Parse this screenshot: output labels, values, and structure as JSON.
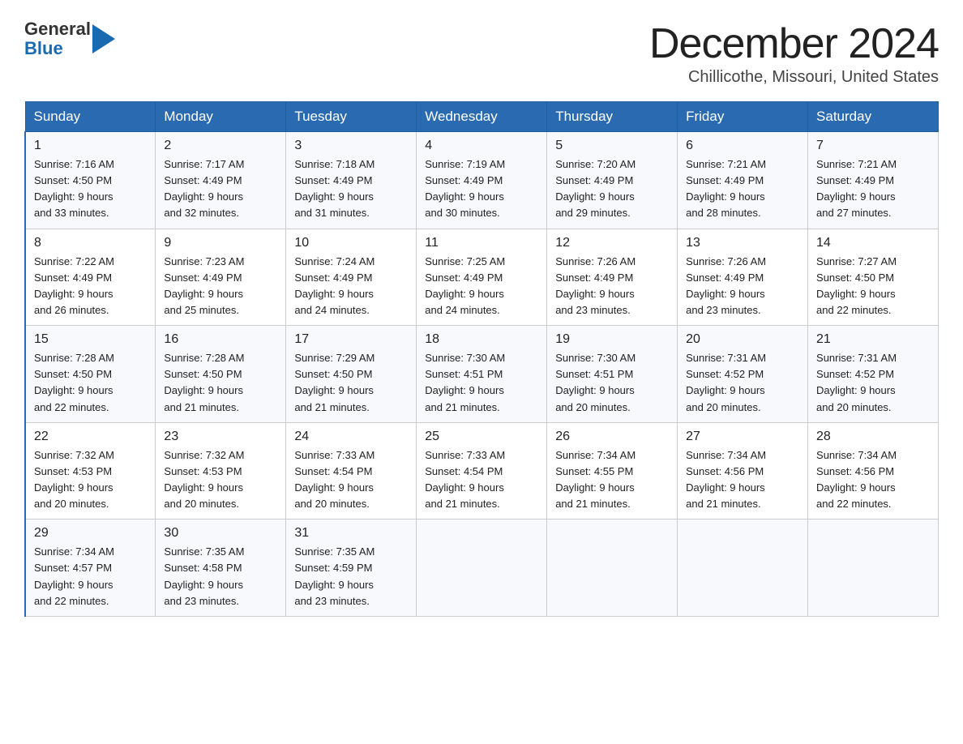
{
  "header": {
    "logo_general": "General",
    "logo_blue": "Blue",
    "month_title": "December 2024",
    "location": "Chillicothe, Missouri, United States"
  },
  "weekdays": [
    "Sunday",
    "Monday",
    "Tuesday",
    "Wednesday",
    "Thursday",
    "Friday",
    "Saturday"
  ],
  "weeks": [
    [
      {
        "day": "1",
        "sunrise": "7:16 AM",
        "sunset": "4:50 PM",
        "daylight": "9 hours and 33 minutes."
      },
      {
        "day": "2",
        "sunrise": "7:17 AM",
        "sunset": "4:49 PM",
        "daylight": "9 hours and 32 minutes."
      },
      {
        "day": "3",
        "sunrise": "7:18 AM",
        "sunset": "4:49 PM",
        "daylight": "9 hours and 31 minutes."
      },
      {
        "day": "4",
        "sunrise": "7:19 AM",
        "sunset": "4:49 PM",
        "daylight": "9 hours and 30 minutes."
      },
      {
        "day": "5",
        "sunrise": "7:20 AM",
        "sunset": "4:49 PM",
        "daylight": "9 hours and 29 minutes."
      },
      {
        "day": "6",
        "sunrise": "7:21 AM",
        "sunset": "4:49 PM",
        "daylight": "9 hours and 28 minutes."
      },
      {
        "day": "7",
        "sunrise": "7:21 AM",
        "sunset": "4:49 PM",
        "daylight": "9 hours and 27 minutes."
      }
    ],
    [
      {
        "day": "8",
        "sunrise": "7:22 AM",
        "sunset": "4:49 PM",
        "daylight": "9 hours and 26 minutes."
      },
      {
        "day": "9",
        "sunrise": "7:23 AM",
        "sunset": "4:49 PM",
        "daylight": "9 hours and 25 minutes."
      },
      {
        "day": "10",
        "sunrise": "7:24 AM",
        "sunset": "4:49 PM",
        "daylight": "9 hours and 24 minutes."
      },
      {
        "day": "11",
        "sunrise": "7:25 AM",
        "sunset": "4:49 PM",
        "daylight": "9 hours and 24 minutes."
      },
      {
        "day": "12",
        "sunrise": "7:26 AM",
        "sunset": "4:49 PM",
        "daylight": "9 hours and 23 minutes."
      },
      {
        "day": "13",
        "sunrise": "7:26 AM",
        "sunset": "4:49 PM",
        "daylight": "9 hours and 23 minutes."
      },
      {
        "day": "14",
        "sunrise": "7:27 AM",
        "sunset": "4:50 PM",
        "daylight": "9 hours and 22 minutes."
      }
    ],
    [
      {
        "day": "15",
        "sunrise": "7:28 AM",
        "sunset": "4:50 PM",
        "daylight": "9 hours and 22 minutes."
      },
      {
        "day": "16",
        "sunrise": "7:28 AM",
        "sunset": "4:50 PM",
        "daylight": "9 hours and 21 minutes."
      },
      {
        "day": "17",
        "sunrise": "7:29 AM",
        "sunset": "4:50 PM",
        "daylight": "9 hours and 21 minutes."
      },
      {
        "day": "18",
        "sunrise": "7:30 AM",
        "sunset": "4:51 PM",
        "daylight": "9 hours and 21 minutes."
      },
      {
        "day": "19",
        "sunrise": "7:30 AM",
        "sunset": "4:51 PM",
        "daylight": "9 hours and 20 minutes."
      },
      {
        "day": "20",
        "sunrise": "7:31 AM",
        "sunset": "4:52 PM",
        "daylight": "9 hours and 20 minutes."
      },
      {
        "day": "21",
        "sunrise": "7:31 AM",
        "sunset": "4:52 PM",
        "daylight": "9 hours and 20 minutes."
      }
    ],
    [
      {
        "day": "22",
        "sunrise": "7:32 AM",
        "sunset": "4:53 PM",
        "daylight": "9 hours and 20 minutes."
      },
      {
        "day": "23",
        "sunrise": "7:32 AM",
        "sunset": "4:53 PM",
        "daylight": "9 hours and 20 minutes."
      },
      {
        "day": "24",
        "sunrise": "7:33 AM",
        "sunset": "4:54 PM",
        "daylight": "9 hours and 20 minutes."
      },
      {
        "day": "25",
        "sunrise": "7:33 AM",
        "sunset": "4:54 PM",
        "daylight": "9 hours and 21 minutes."
      },
      {
        "day": "26",
        "sunrise": "7:34 AM",
        "sunset": "4:55 PM",
        "daylight": "9 hours and 21 minutes."
      },
      {
        "day": "27",
        "sunrise": "7:34 AM",
        "sunset": "4:56 PM",
        "daylight": "9 hours and 21 minutes."
      },
      {
        "day": "28",
        "sunrise": "7:34 AM",
        "sunset": "4:56 PM",
        "daylight": "9 hours and 22 minutes."
      }
    ],
    [
      {
        "day": "29",
        "sunrise": "7:34 AM",
        "sunset": "4:57 PM",
        "daylight": "9 hours and 22 minutes."
      },
      {
        "day": "30",
        "sunrise": "7:35 AM",
        "sunset": "4:58 PM",
        "daylight": "9 hours and 23 minutes."
      },
      {
        "day": "31",
        "sunrise": "7:35 AM",
        "sunset": "4:59 PM",
        "daylight": "9 hours and 23 minutes."
      },
      null,
      null,
      null,
      null
    ]
  ]
}
